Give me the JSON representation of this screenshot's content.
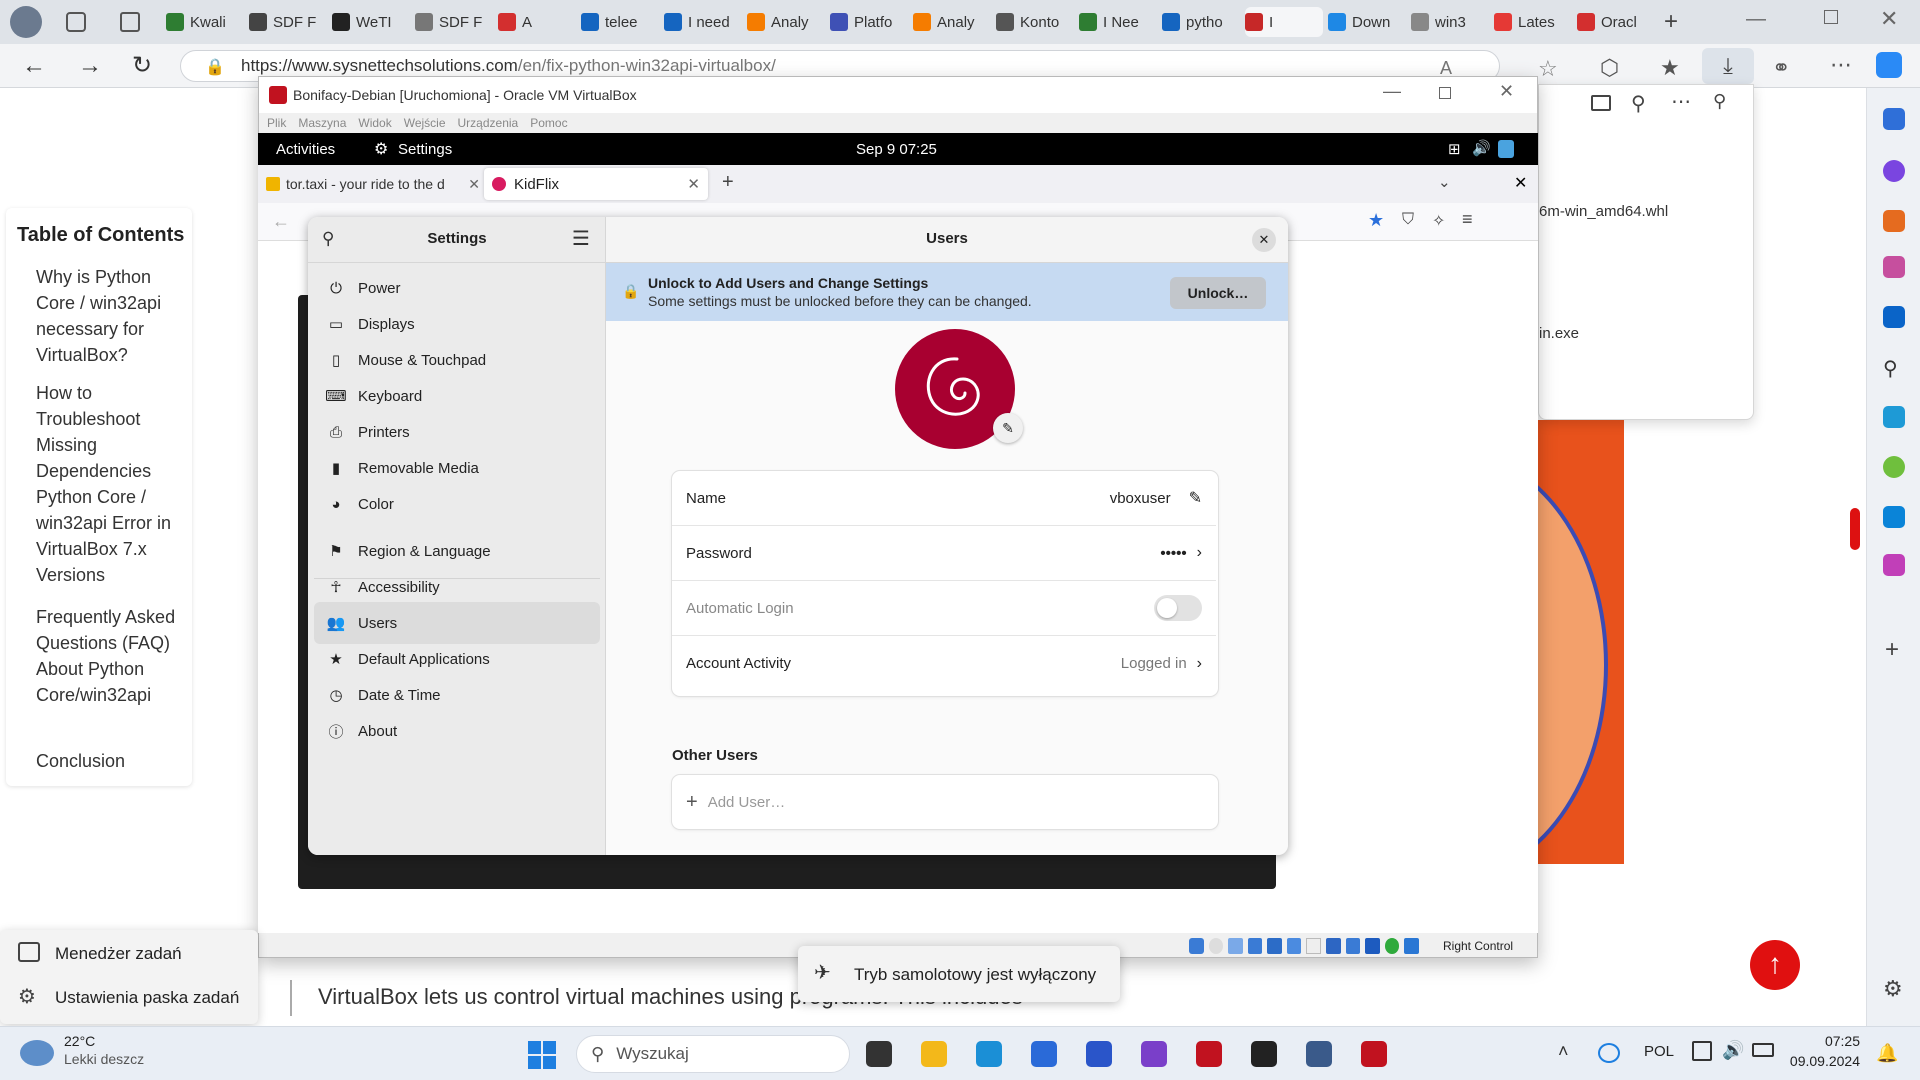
{
  "browser": {
    "tabs": [
      "Kwali",
      "SDF F",
      "WeTI",
      "SDF F",
      "A",
      "telee",
      "I need",
      "Analy",
      "Platfo",
      "Analy",
      "Konto",
      "I Nee",
      "pytho",
      "I",
      "Down",
      "win3",
      "Lates",
      "Oracl"
    ],
    "url_host": "https://www.sysnettechsolutions.com",
    "url_path": "/en/fix-python-win32api-virtualbox/",
    "download_file_1": "6m-win_amd64.whl",
    "download_file_2": "in.exe"
  },
  "page": {
    "toc_title": "Table of Contents",
    "toc_items": [
      "Why is Python Core / win32api necessary for VirtualBox?",
      "How to Troubleshoot Missing Dependencies Python Core / win32api Error in VirtualBox 7.x Versions",
      "Frequently Asked Questions (FAQ) About Python Core/win32api",
      "Conclusion"
    ],
    "body_text": "VirtualBox lets us control virtual machines using programs. This includes"
  },
  "jumplist": {
    "task_manager": "Menedżer zadań",
    "taskbar_settings": "Ustawienia paska zadań"
  },
  "toast": {
    "text": "Tryb samolotowy jest wyłączony"
  },
  "vbox": {
    "title": "Bonifacy-Debian [Uruchomiona] - Oracle VM VirtualBox",
    "menu": [
      "Plik",
      "Maszyna",
      "Widok",
      "Wejście",
      "Urządzenia",
      "Pomoc"
    ],
    "host_key": "Right Control"
  },
  "gnome": {
    "activities": "Activities",
    "app": "Settings",
    "clock": "Sep 9  07:25",
    "ff_tab1": "tor.taxi - your ride to the d",
    "ff_tab2": "KidFlix"
  },
  "settings": {
    "sidebar_title": "Settings",
    "panel_title": "Users",
    "items": [
      "Power",
      "Displays",
      "Mouse & Touchpad",
      "Keyboard",
      "Printers",
      "Removable Media",
      "Color",
      "Region & Language",
      "Accessibility",
      "Users",
      "Default Applications",
      "Date & Time",
      "About"
    ],
    "icons": [
      "power-icon",
      "display-icon",
      "mouse-icon",
      "keyboard-icon",
      "printer-icon",
      "usb-icon",
      "color-icon",
      "flag-icon",
      "accessibility-icon",
      "users-icon",
      "star-icon",
      "clock-icon",
      "info-icon"
    ],
    "active_item": "Users",
    "banner_title": "Unlock to Add Users and Change Settings",
    "banner_sub": "Some settings must be unlocked before they can be changed.",
    "unlock_label": "Unlock…",
    "rows": {
      "name_label": "Name",
      "name_value": "vboxuser",
      "password_label": "Password",
      "password_value": "•••••",
      "autologin_label": "Automatic Login",
      "activity_label": "Account Activity",
      "activity_value": "Logged in"
    },
    "other_users": "Other Users",
    "add_user": "Add User…",
    "colors": {
      "debian": "#a80030",
      "banner": "#c6daf2"
    }
  },
  "taskbar": {
    "temp": "22°C",
    "weather": "Lekki deszcz",
    "search_placeholder": "Wyszukaj",
    "lang": "POL",
    "time": "07:25",
    "date": "09.09.2024"
  }
}
